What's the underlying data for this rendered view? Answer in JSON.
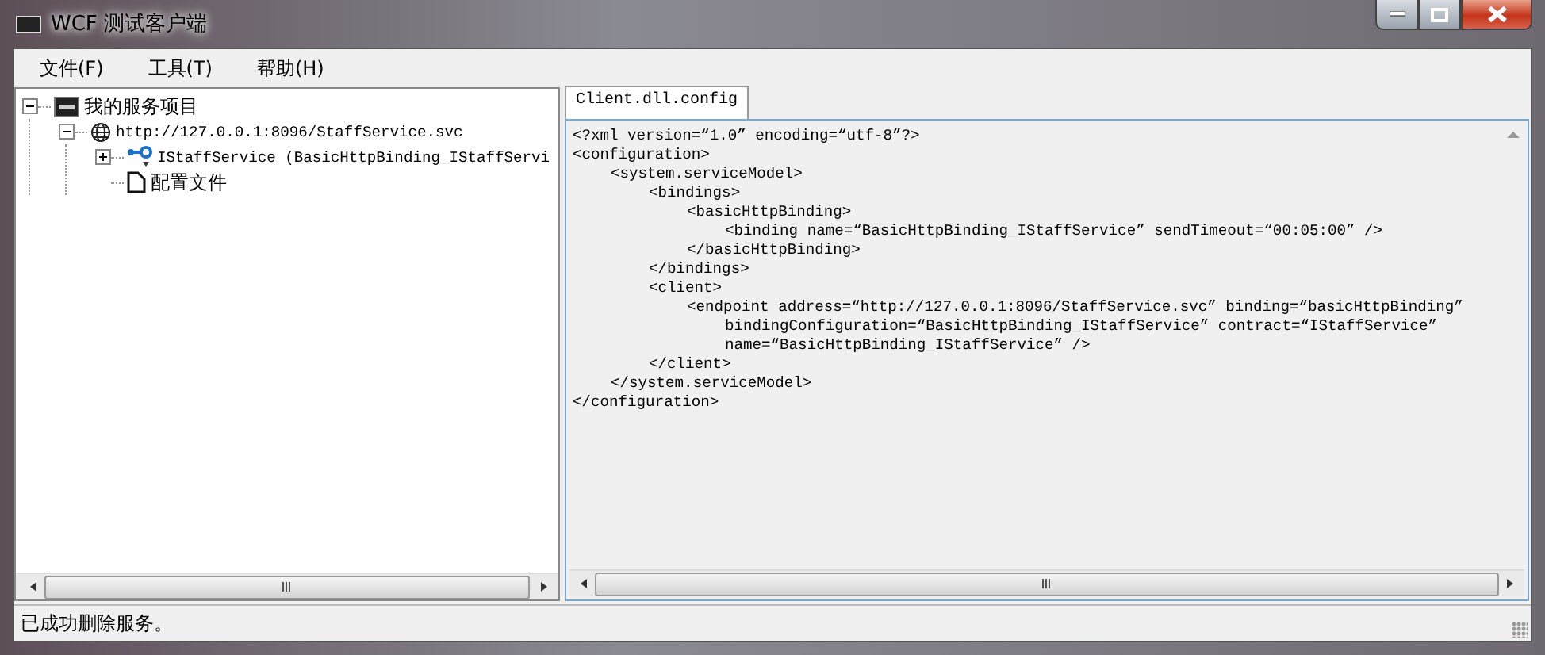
{
  "window": {
    "title": "WCF 测试客户端"
  },
  "menu": [
    "文件(F)",
    "工具(T)",
    "帮助(H)"
  ],
  "tree": {
    "items": [
      {
        "label": "我的服务项目",
        "kind": "root",
        "expanded": true,
        "children": [
          {
            "label": "http://127.0.0.1:8096/StaffService.svc",
            "kind": "service",
            "expanded": true,
            "children": [
              {
                "label": "IStaffService (BasicHttpBinding_IStaffServi",
                "kind": "contract",
                "expanded": false
              },
              {
                "label": "配置文件",
                "kind": "file"
              }
            ]
          }
        ]
      }
    ]
  },
  "tabs": [
    {
      "label": "Client.dll.config",
      "selected": true
    }
  ],
  "code": [
    {
      "lines": [
        "<?xml version=“1.0” encoding=“utf-8”?>"
      ]
    },
    {
      "lines": [
        "<configuration>"
      ],
      "close": "</configuration>",
      "children": [
        {
          "lines": [
            "<system.serviceModel>"
          ],
          "close": "</system.serviceModel>",
          "children": [
            {
              "lines": [
                "<bindings>"
              ],
              "close": "</bindings>",
              "children": [
                {
                  "lines": [
                    "<basicHttpBinding>"
                  ],
                  "close": "</basicHttpBinding>",
                  "children": [
                    {
                      "lines": [
                        "<binding name=“BasicHttpBinding_IStaffService” sendTimeout=“00:05:00” />"
                      ]
                    }
                  ]
                }
              ]
            },
            {
              "lines": [
                "<client>"
              ],
              "close": "</client>",
              "children": [
                {
                  "lines": [
                    "<endpoint address=“http://127.0.0.1:8096/StaffService.svc” binding=“basicHttpBinding”",
                    "bindingConfiguration=“BasicHttpBinding_IStaffService” contract=“IStaffService”",
                    "name=“BasicHttpBinding_IStaffService” />"
                  ]
                }
              ]
            }
          ]
        }
      ]
    }
  ],
  "status_bar": "已成功删除服务。"
}
